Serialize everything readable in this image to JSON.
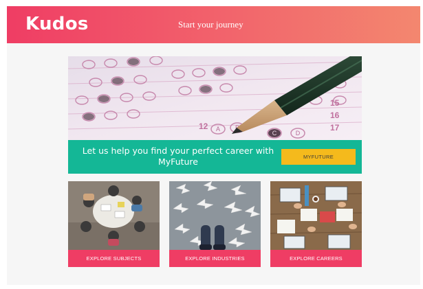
{
  "header": {
    "logo": "Kudos",
    "tagline": "Start your journey"
  },
  "hero": {
    "image": "answer-sheet-with-pencil",
    "bubble_letters": [
      "A",
      "B",
      "C",
      "D"
    ],
    "row_numbers": [
      "12",
      "15",
      "16",
      "17"
    ]
  },
  "cta": {
    "text": "Let us help you find your perfect career with MyFuture",
    "button_label": "MYFUTURE"
  },
  "cards": [
    {
      "image": "students-around-table-photo",
      "button_label": "EXPLORE SUBJECTS"
    },
    {
      "image": "arrows-on-floor-photo",
      "button_label": "EXPLORE INDUSTRIES"
    },
    {
      "image": "desk-overhead-photo",
      "button_label": "EXPLORE CAREERS"
    }
  ],
  "colors": {
    "header_gradient": [
      "#ef3d64",
      "#f3876f"
    ],
    "cta_band": "#14b796",
    "cta_button": "#f5ba1c",
    "card_button": "#ef3d64"
  }
}
